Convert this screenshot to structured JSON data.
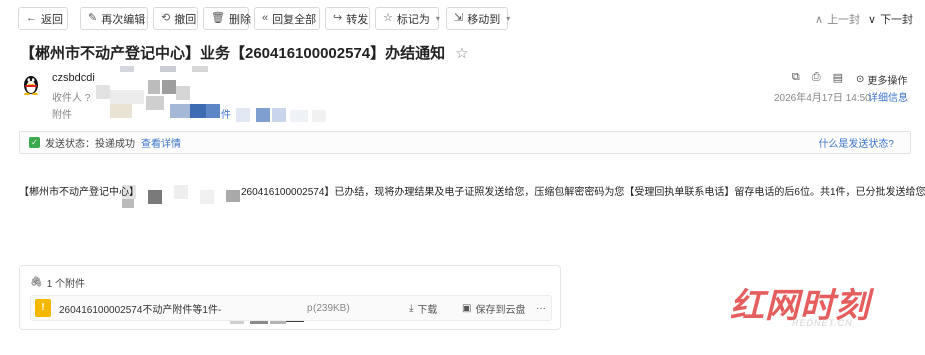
{
  "toolbar": {
    "back": "返回",
    "edit_again": "再次编辑",
    "recall": "撤回",
    "delete": "删除",
    "reply_all": "回复全部",
    "forward": "转发",
    "mark_as": "标记为",
    "move_to": "移动到",
    "prev": "上一封",
    "next": "下一封"
  },
  "mail": {
    "subject": "【郴州市不动产登记中心】业务【260416100002574】办结通知",
    "sender": "czsbdcdi",
    "recipient_label": "收件人",
    "attachment_label": "附件",
    "more_ops": "更多操作",
    "date": "2026年4月17日 14:50",
    "details": "详细信息"
  },
  "status": {
    "label": "发送状态：",
    "value": "投递成功",
    "view_details": "查看详情",
    "what_is": "什么是发送状态?"
  },
  "body": {
    "start": "【郴州市不动产登记中心】",
    "end": "260416100002574】已办结，现将办理结果及电子证照发送给您，压缩包解密密码为您【受理回执单联系电话】留存电话的后6位。共1件，已分批发送给您"
  },
  "attachment": {
    "count_label": "1 个附件",
    "file_name": "260416100002574不动产附件等1件-",
    "file_ext": "p",
    "file_size": "(239KB)",
    "download": "下载",
    "save_cloud": "保存到云盘",
    "more": "···"
  },
  "watermark": {
    "main": "红网时刻",
    "sub": "REDNET.CN"
  }
}
